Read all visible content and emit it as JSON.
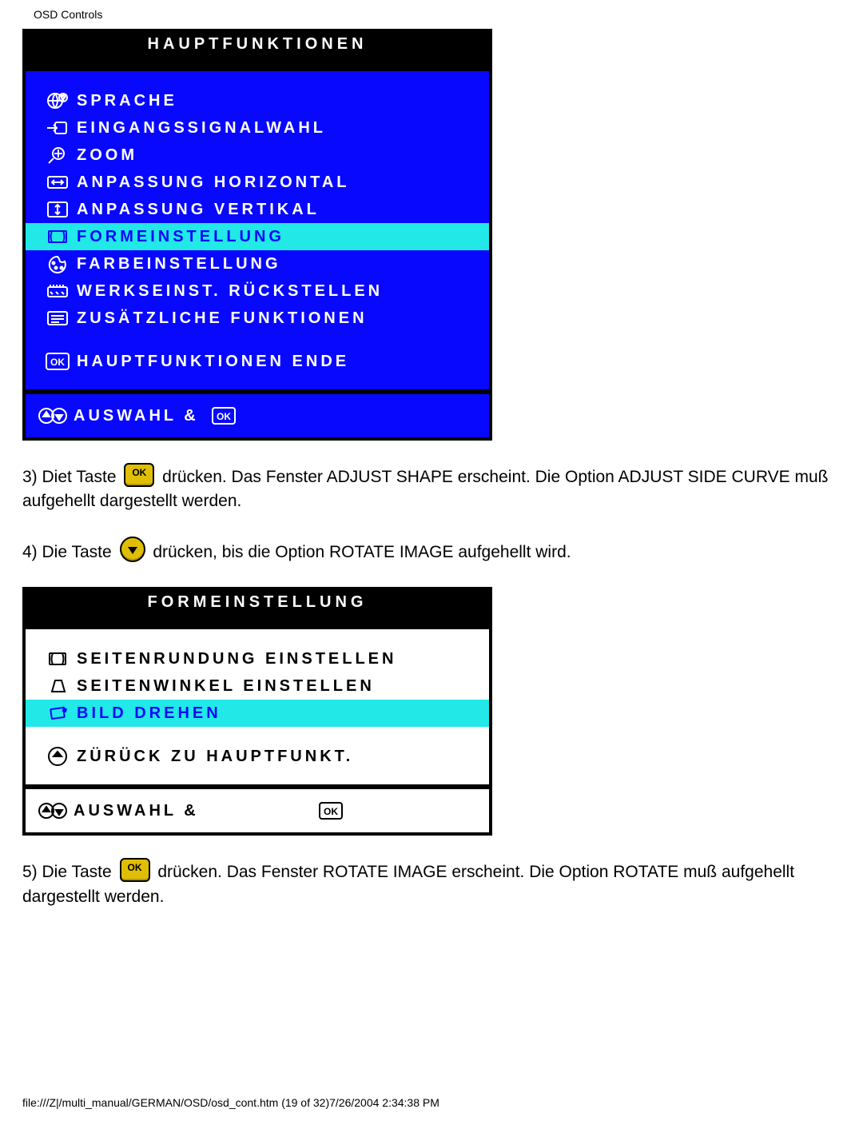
{
  "page_title": "OSD Controls",
  "osd1": {
    "header": "HAUPTFUNKTIONEN",
    "items": [
      {
        "icon": "globe",
        "label": "SPRACHE",
        "sel": false
      },
      {
        "icon": "input",
        "label": "EINGANGSSIGNALWAHL",
        "sel": false
      },
      {
        "icon": "zoom",
        "label": "ZOOM",
        "sel": false
      },
      {
        "icon": "horiz",
        "label": "ANPASSUNG HORIZONTAL",
        "sel": false
      },
      {
        "icon": "vert",
        "label": "ANPASSUNG VERTIKAL",
        "sel": false
      },
      {
        "icon": "shape",
        "label": "FORMEINSTELLUNG",
        "sel": true
      },
      {
        "icon": "color",
        "label": "FARBEINSTELLUNG",
        "sel": false
      },
      {
        "icon": "reset",
        "label": "WERKSEINST. RÜCKSTELLEN",
        "sel": false
      },
      {
        "icon": "extra",
        "label": "ZUSÄTZLICHE FUNKTIONEN",
        "sel": false
      }
    ],
    "close": {
      "icon": "ok",
      "label": "HAUPTFUNKTIONEN ENDE"
    },
    "footer": {
      "label": "AUSWAHL &"
    }
  },
  "step3_a": "3) Diet Taste ",
  "step3_b": " drücken. Das Fenster ADJUST SHAPE erscheint. Die Option ADJUST SIDE CURVE muß aufgehellt dargestellt werden.",
  "step4_a": "4) Die Taste ",
  "step4_b": " drücken, bis die Option ROTATE IMAGE aufgehellt wird.",
  "osd2": {
    "header": "FORMEINSTELLUNG",
    "items": [
      {
        "icon": "curve",
        "label": "SEITENRUNDUNG EINSTELLEN",
        "sel": false
      },
      {
        "icon": "angle",
        "label": "SEITENWINKEL EINSTELLEN",
        "sel": false
      },
      {
        "icon": "rotate",
        "label": "BILD DREHEN",
        "sel": true
      }
    ],
    "back": {
      "icon": "back",
      "label": "ZÜRÜCK ZU HAUPTFUNKT."
    },
    "footer": {
      "label": "AUSWAHL &"
    }
  },
  "step5_a": "5) Die Taste ",
  "step5_b": " drücken. Das Fenster ROTATE IMAGE erscheint. Die Option ROTATE muß aufgehellt dargestellt werden.",
  "footer_text": "file:///Z|/multi_manual/GERMAN/OSD/osd_cont.htm (19 of 32)7/26/2004 2:34:38 PM"
}
